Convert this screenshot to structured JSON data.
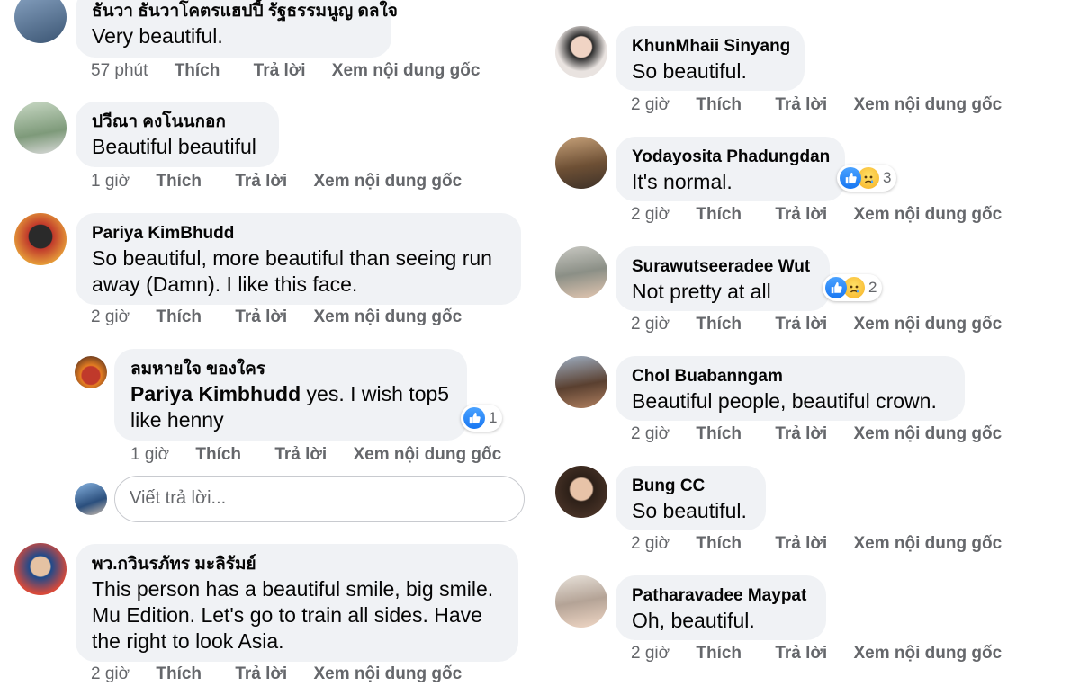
{
  "actions": {
    "like": "Thích",
    "reply": "Trả lời",
    "see_original": "Xem nội dung gốc"
  },
  "left_column": [
    {
      "author": "ธันวา ธันวาโคตรแฮปปี้ รัฐธรรมนูญ ดลใจ",
      "text": "Very beautiful.",
      "time": "57 phút",
      "avatar": "avatar"
    },
    {
      "author": "ปวีณา คงโนนกอก",
      "text": "Beautiful beautiful",
      "time": "1 giờ",
      "avatar": "avatar"
    },
    {
      "author": "Pariya KimBhudd",
      "text": "So beautiful, more beautiful than seeing run away (Damn). I like this face.",
      "time": "2 giờ",
      "avatar": "avatar"
    },
    {
      "author": "ลมหายใจ ของใคร",
      "mention": "Pariya Kimbhudd",
      "text": " yes. I wish top5 like henny",
      "time": "1 giờ",
      "reaction_count": "1",
      "avatar": "avatar"
    },
    {
      "author": "พว.กวินรภัทร มะลิรัมย์",
      "text": "This person has a beautiful smile, big smile. Mu Edition. Let's go to train all sides. Have the right to look Asia.",
      "time": "2 giờ",
      "avatar": "avatar"
    }
  ],
  "reply_input": {
    "placeholder": "Viết trả lời..."
  },
  "right_column": [
    {
      "author": "KhunMhaii Sinyang",
      "text": "So beautiful.",
      "time": "2 giờ"
    },
    {
      "author": "Yodayosita Phadungdan",
      "text": "It's normal.",
      "time": "2 giờ",
      "reaction_count": "3"
    },
    {
      "author": "Surawutseeradee Wut",
      "text": "Not pretty at all",
      "time": "2 giờ",
      "reaction_count": "2"
    },
    {
      "author": "Chol Buabanngam",
      "text": "Beautiful people, beautiful crown.",
      "time": "2 giờ"
    },
    {
      "author": "Bung CC",
      "text": "So beautiful.",
      "time": "2 giờ"
    },
    {
      "author": "Patharavadee Maypat",
      "text": "Oh, beautiful.",
      "time": "2 giờ"
    }
  ],
  "colors": {
    "bubble": "#f0f2f5",
    "secondary_text": "#65676b",
    "like_blue": "#1877f2"
  }
}
